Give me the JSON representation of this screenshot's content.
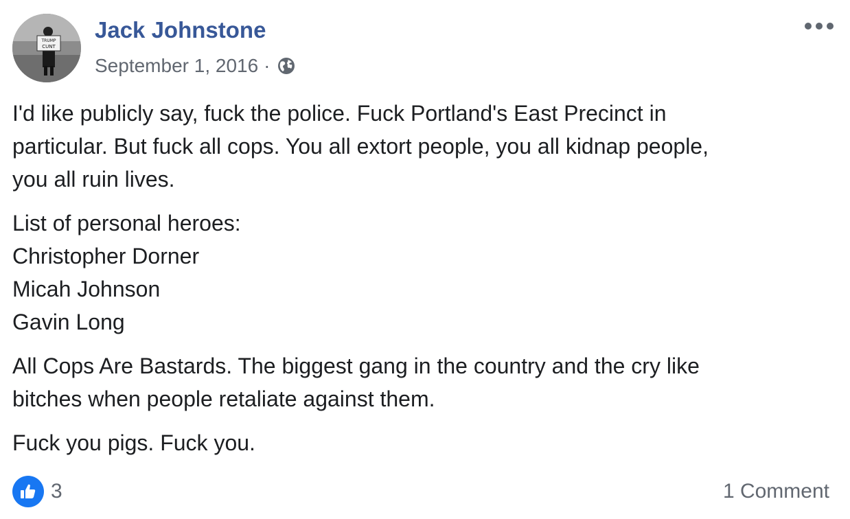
{
  "post": {
    "author": "Jack Johnstone",
    "date": "September 1, 2016",
    "separator": "·",
    "privacy_icon": "globe-icon",
    "avatar_sign_text": "TRUMP IS A CUNT",
    "paragraphs": [
      [
        "I'd like publicly say, fuck the police. Fuck Portland's East Precinct in",
        "particular. But fuck all cops. You all extort people, you all kidnap people,",
        "you all ruin lives."
      ],
      [
        "List of personal heroes:",
        "Christopher Dorner",
        "Micah Johnson",
        "Gavin Long"
      ],
      [
        "All Cops Are Bastards. The biggest gang in the country and the cry like",
        "bitches when people retaliate against them."
      ],
      [
        "Fuck you pigs. Fuck you."
      ]
    ]
  },
  "footer": {
    "like_icon": "thumbs-up-icon",
    "like_count": "3",
    "comments_label": "1 Comment"
  },
  "colors": {
    "author_link": "#385898",
    "meta_text": "#616770",
    "like_blue": "#1877f2"
  }
}
